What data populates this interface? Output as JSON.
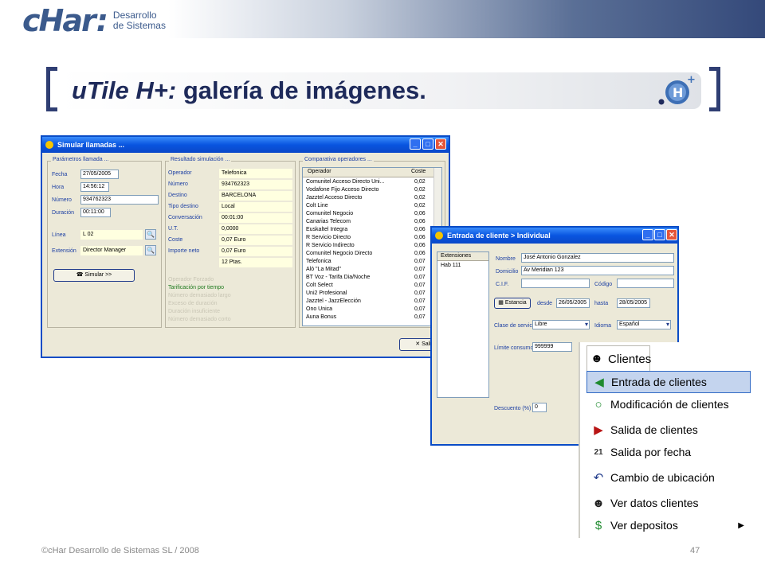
{
  "header": {
    "logo": "cHar",
    "logo_mark": ":",
    "logo_sub1": "Desarrollo",
    "logo_sub2": "de Sistemas"
  },
  "slide": {
    "title_italic": "uTile H+:",
    "title_rest": " galería de imágenes."
  },
  "footer": {
    "copyright": "©cHar Desarrollo de Sistemas SL / 2008",
    "page": "47"
  },
  "win1": {
    "title": "Simular llamadas ...",
    "group_params": "Parámetros llamada ...",
    "fecha_label": "Fecha",
    "fecha": "27/05/2005",
    "hora_label": "Hora",
    "hora": "14:56:12",
    "numero_label": "Número",
    "numero": "934762323",
    "duracion_label": "Duración",
    "duracion": "00:11:00",
    "linea_label": "Línea",
    "linea": "L 02",
    "extension_label": "Extensión",
    "extension": "Director Manager",
    "simular": "Simular >>",
    "group_result": "Resultado simulación ...",
    "results": [
      {
        "label": "Operador",
        "value": "Telefonica"
      },
      {
        "label": "Número",
        "value": "934762323"
      },
      {
        "label": "Destino",
        "value": "BARCELONA"
      },
      {
        "label": "Tipo destino",
        "value": "Local"
      },
      {
        "label": "Conversación",
        "value": "00:01:00"
      },
      {
        "label": "U.T.",
        "value": "0,0000"
      },
      {
        "label": "Coste",
        "value": "0,07 Euro"
      },
      {
        "label": "Importe neto",
        "value": "0,07 Euro"
      },
      {
        "label": "",
        "value": "12 Ptas."
      }
    ],
    "operador_forzado": "Operador Forzado",
    "tarificacion": "Tarificación por tiempo",
    "numero_largo": "Número demasiado largo",
    "exceso": "Exceso de duración",
    "duracion_insuf": "Duración insuficiente",
    "numero_corto": "Número demasiado corto",
    "group_comp": "Comparativa operadores ...",
    "col_operador": "Operador",
    "col_coste": "Coste",
    "operators": [
      {
        "name": "Comunitel Acceso Directo Uni...",
        "cost": "0,02"
      },
      {
        "name": "Vodafone Fijo Acceso Directo",
        "cost": "0,02"
      },
      {
        "name": "Jazztel Acceso Directo",
        "cost": "0,02"
      },
      {
        "name": "Colt Line",
        "cost": "0,02"
      },
      {
        "name": "Comunitel Negocio",
        "cost": "0,06"
      },
      {
        "name": "Canarias Telecom",
        "cost": "0,06"
      },
      {
        "name": "Euskaltel Integra",
        "cost": "0,06"
      },
      {
        "name": "R Servicio Directo",
        "cost": "0,06"
      },
      {
        "name": "R Servicio Indirecto",
        "cost": "0,06"
      },
      {
        "name": "Comunitel Negocio Directo",
        "cost": "0,06"
      },
      {
        "name": "Telefonica",
        "cost": "0,07"
      },
      {
        "name": "Aló \"La Mitad\"",
        "cost": "0,07"
      },
      {
        "name": "BT Voz - Tarifa Dia/Noche",
        "cost": "0,07"
      },
      {
        "name": "Colt Select",
        "cost": "0,07"
      },
      {
        "name": "Uni2 Profesional",
        "cost": "0,07"
      },
      {
        "name": "Jazztel - JazzElección",
        "cost": "0,07"
      },
      {
        "name": "Ono Unica",
        "cost": "0,07"
      },
      {
        "name": "Auna Bonus",
        "cost": "0,07"
      }
    ],
    "salir": "Sali"
  },
  "win2": {
    "title": "Entrada de cliente > Individual",
    "list_header": "Extensiones",
    "list_item": "Hab 111",
    "nombre_label": "Nombre",
    "nombre": "José Antonio Gonzalez",
    "domicilio_label": "Domicilio",
    "domicilio": "Av Meridian 123",
    "cif_label": "C.I.F.",
    "codigo_label": "Código",
    "estancia": "Estancia",
    "desde_label": "desde",
    "desde": "26/05/2005",
    "hasta_label": "hasta",
    "hasta": "28/05/2005",
    "clase_label": "Clase de servicio",
    "clase": "Libre",
    "idioma_label": "Idioma",
    "idioma": "Español",
    "limite_label": "Límite consumo",
    "limite": "999999",
    "descuento_label": "Descuento (%)",
    "descuento": "0"
  },
  "menu": {
    "tab_label": "Clientes",
    "items": [
      {
        "label": "Entrada de clientes",
        "icon": "green-arrow-icon"
      },
      {
        "label": "Modificación de clientes",
        "icon": "green-circle-icon"
      },
      {
        "label": "Salida de clientes",
        "icon": "red-arrow-icon"
      },
      {
        "label": "Salida por fecha",
        "icon": "calendar-icon",
        "icon_text": "21"
      },
      {
        "label": "Cambio de ubicación",
        "icon": "undo-arrow-icon"
      },
      {
        "label": "Ver datos clientes",
        "icon": "person-icon"
      },
      {
        "label": "Ver depositos",
        "icon": "money-icon"
      }
    ]
  }
}
